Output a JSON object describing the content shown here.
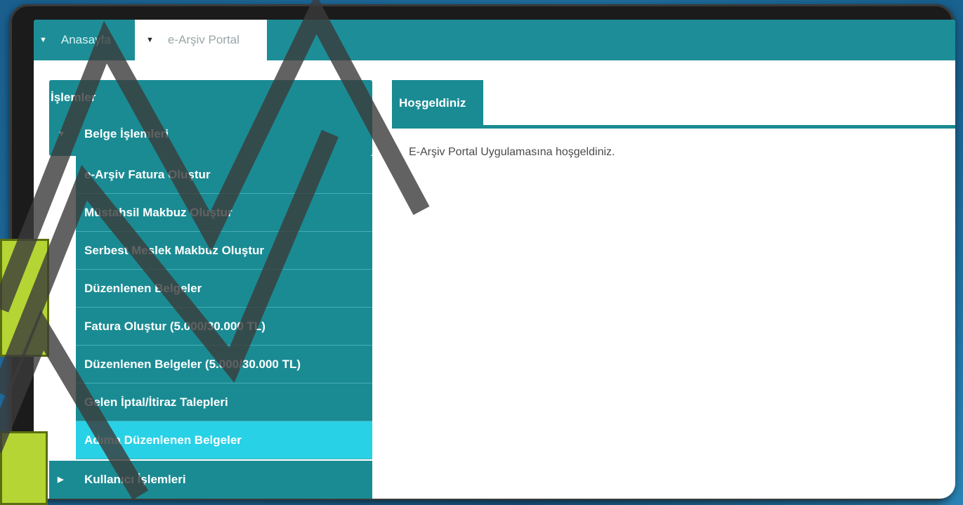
{
  "topbar": {
    "home_tab": "Anasayfa",
    "portal_tab": "e-Arşiv Portal"
  },
  "sidebar": {
    "title": "İşlemler",
    "group_belge": "Belge İşlemleri",
    "items": [
      "e-Arşiv Fatura Oluştur",
      "Müstahsil Makbuz Oluştur",
      "Serbest Meslek Makbuz Oluştur",
      "Düzenlenen Belgeler",
      "Fatura Oluştur (5.000/30.000 TL)",
      "Düzenlenen Belgeler (5.000/30.000 TL)",
      "Gelen İptal/İtiraz Talepleri",
      "Adıma Düzenlenen Belgeler"
    ],
    "group_kullanici": "Kullanıcı İşlemleri"
  },
  "content": {
    "tab_label": "Hoşgeldiniz",
    "welcome_text": "E-Arşiv Portal Uygulamasına hoşgeldiniz."
  },
  "colors": {
    "teal": "#1a8b93",
    "active": "#29d1e6",
    "background_blue": "#1f6fa0",
    "accent_green": "#b5d534"
  },
  "icons": {
    "caret_down": "caret-down-icon",
    "caret_right": "caret-right-icon"
  }
}
